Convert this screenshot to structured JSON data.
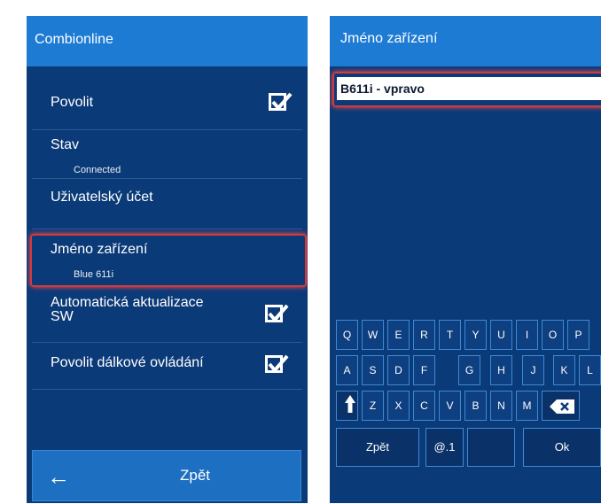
{
  "left_panel": {
    "title": "Combionline",
    "items": [
      {
        "label": "Povolit",
        "checked": true
      },
      {
        "label": "Stav",
        "value": "Connected"
      },
      {
        "label": "Uživatelský účet"
      },
      {
        "label": "Jméno zařízení",
        "value": "Blue 611i"
      },
      {
        "label_line1": "Automatická aktualizace",
        "label_line2": "SW",
        "checked": true
      },
      {
        "label": "Povolit dálkové ovládání",
        "checked": true
      }
    ],
    "back_button": {
      "icon": "left-arrow-icon",
      "label": "Zpět"
    }
  },
  "right_panel": {
    "title": "Jméno zařízení",
    "input_value": "B611i - vpravo",
    "keyboard": {
      "row1": [
        "Q",
        "W",
        "E",
        "R",
        "T",
        "Y",
        "U",
        "I",
        "O",
        "P"
      ],
      "row2": [
        "A",
        "S",
        "D",
        "F",
        "G",
        "H",
        "J",
        "K",
        "L"
      ],
      "row3": [
        "Z",
        "X",
        "C",
        "V",
        "B",
        "N",
        "M"
      ],
      "row4": [
        "Zpět",
        "@.1",
        "Ok"
      ],
      "shift_icon": "shift-arrow-icon",
      "backspace_icon": "backspace-icon"
    }
  },
  "colors": {
    "panel_bg": "#0b3a78",
    "title_bg": "#1d7bd4",
    "highlight": "#d43a3a"
  }
}
